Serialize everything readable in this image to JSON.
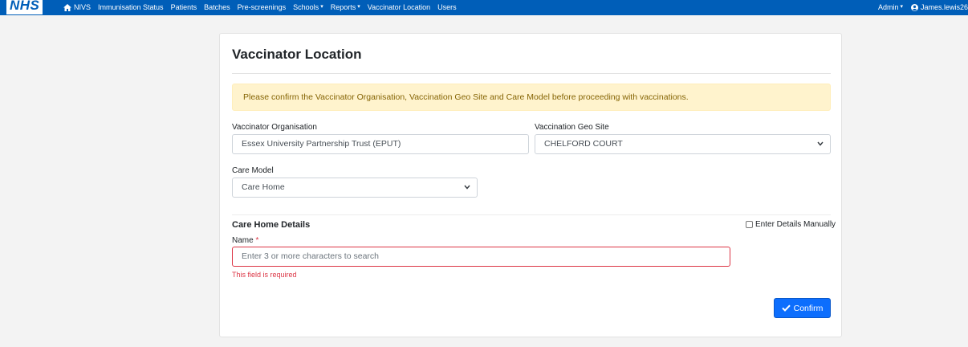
{
  "brand": {
    "logo_text": "NHS"
  },
  "nav": {
    "items": [
      {
        "label": "NIVS",
        "icon": "home-icon",
        "dropdown": false
      },
      {
        "label": "Immunisation Status",
        "dropdown": false
      },
      {
        "label": "Patients",
        "dropdown": false
      },
      {
        "label": "Batches",
        "dropdown": false
      },
      {
        "label": "Pre-screenings",
        "dropdown": false
      },
      {
        "label": "Schools",
        "dropdown": true
      },
      {
        "label": "Reports",
        "dropdown": true
      },
      {
        "label": "Vaccinator Location",
        "dropdown": false
      },
      {
        "label": "Users",
        "dropdown": false
      }
    ],
    "admin_label": "Admin",
    "user_label": "James.lewis26"
  },
  "page": {
    "title": "Vaccinator Location",
    "alert": "Please confirm the Vaccinator Organisation, Vaccination Geo Site and Care Model before proceeding with vaccinations."
  },
  "form": {
    "org_label": "Vaccinator Organisation",
    "org_value": "Essex University Partnership Trust (EPUT)",
    "geo_label": "Vaccination Geo Site",
    "geo_value": "CHELFORD COURT",
    "care_model_label": "Care Model",
    "care_model_value": "Care Home"
  },
  "care_home": {
    "section_title": "Care Home Details",
    "manual_label": "Enter Details Manually",
    "name_label": "Name",
    "required_mark": "*",
    "name_placeholder": "Enter 3 or more characters to search",
    "error_text": "This field is required"
  },
  "actions": {
    "confirm_label": "Confirm"
  },
  "colors": {
    "nav_bg": "#005eb8",
    "alert_bg": "#fff3cd",
    "alert_text": "#856404",
    "error": "#dc3545",
    "primary": "#0d6efd"
  }
}
